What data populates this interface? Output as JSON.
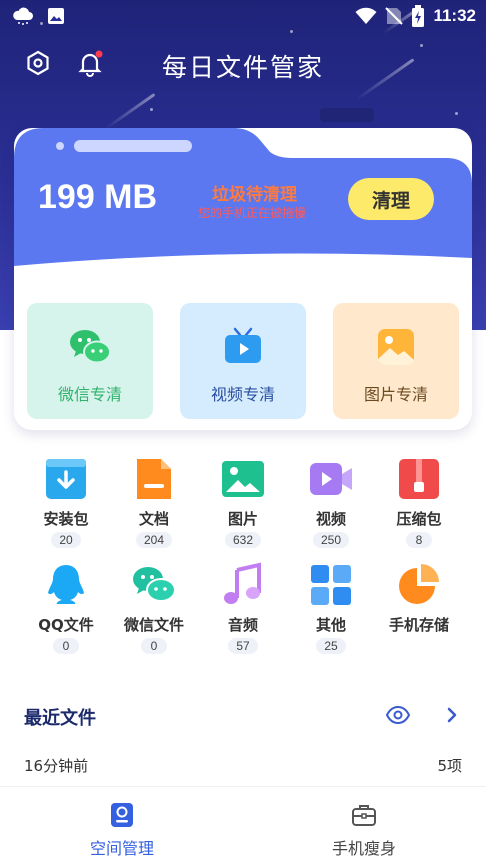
{
  "status_bar": {
    "time": "11:32",
    "icons": [
      "cloud-icon",
      "image-icon",
      "wifi-icon",
      "no-sim-icon",
      "battery-charging-icon"
    ]
  },
  "header": {
    "title": "每日文件管家",
    "icons": [
      "settings-hex-icon",
      "bell-icon"
    ]
  },
  "storage": {
    "size": "199 MB",
    "junk_title": "垃圾待清理",
    "junk_subtitle": "您的手机正在被拖慢",
    "clean_button": "清理"
  },
  "quick_clean": [
    {
      "label": "微信专清",
      "icon": "wechat-icon",
      "bg": "#d6f3ec",
      "color": "#2fb36a"
    },
    {
      "label": "视频专清",
      "icon": "tv-icon",
      "bg": "#d4ecfd",
      "color": "#2a4ea0"
    },
    {
      "label": "图片专清",
      "icon": "picture-icon",
      "bg": "#ffe8cc",
      "color": "#6b4a1f"
    }
  ],
  "categories": [
    {
      "label": "安装包",
      "count": "20",
      "icon": "download-box-icon"
    },
    {
      "label": "文档",
      "count": "204",
      "icon": "document-icon"
    },
    {
      "label": "图片",
      "count": "632",
      "icon": "image-icon"
    },
    {
      "label": "视频",
      "count": "250",
      "icon": "video-camera-icon"
    },
    {
      "label": "压缩包",
      "count": "8",
      "icon": "zip-icon"
    },
    {
      "label": "QQ文件",
      "count": "0",
      "icon": "qq-icon"
    },
    {
      "label": "微信文件",
      "count": "0",
      "icon": "wechat-icon"
    },
    {
      "label": "音频",
      "count": "57",
      "icon": "music-icon"
    },
    {
      "label": "其他",
      "count": "25",
      "icon": "grid-icon"
    },
    {
      "label": "手机存储",
      "count": "",
      "icon": "pie-chart-icon"
    }
  ],
  "recent": {
    "title": "最近文件",
    "time": "16分钟前",
    "count": "5项"
  },
  "bottom_nav": [
    {
      "label": "空间管理",
      "active": true,
      "icon": "storage-icon"
    },
    {
      "label": "手机瘦身",
      "active": false,
      "icon": "toolbox-icon"
    }
  ],
  "colors": {
    "hero_top": "#1f2378",
    "folder_blue": "#5b78f0",
    "active_nav": "#3560e0",
    "accent_yellow": "#fde96a"
  }
}
